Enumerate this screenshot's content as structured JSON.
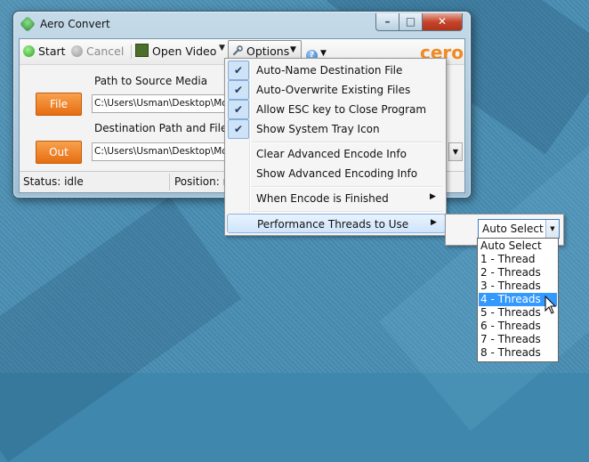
{
  "window": {
    "title": "Aero Convert",
    "controls": {
      "minimize": "–",
      "maximize": "□",
      "close": "✕"
    }
  },
  "toolbar": {
    "start": "Start",
    "cancel": "Cancel",
    "open_video": "Open Video",
    "options": "Options",
    "logo": "cero"
  },
  "source": {
    "label": "Path to Source Media",
    "button": "File",
    "path": "C:\\Users\\Usman\\Desktop\\Movies"
  },
  "destination": {
    "label": "Destination Path and Filename",
    "button": "Out",
    "path": "C:\\Users\\Usman\\Desktop\\Movies"
  },
  "status": {
    "status_text": "Status: idle",
    "position_text": "Position: n/a"
  },
  "options_menu": {
    "items": [
      {
        "label": "Auto-Name Destination File",
        "checked": true
      },
      {
        "label": "Auto-Overwrite Existing Files",
        "checked": true
      },
      {
        "label": "Allow ESC key to Close Program",
        "checked": true
      },
      {
        "label": "Show System Tray Icon",
        "checked": true
      },
      {
        "label": "Clear Advanced Encode Info"
      },
      {
        "label": "Show Advanced Encoding Info"
      },
      {
        "label": "When Encode is Finished",
        "submenu": true
      },
      {
        "label": "Performance Threads to Use",
        "submenu": true,
        "highlighted": true
      }
    ]
  },
  "threads": {
    "selected": "Auto Select",
    "options": [
      "Auto Select",
      "1 - Thread",
      "2 - Threads",
      "3 - Threads",
      "4 - Threads",
      "5 - Threads",
      "6 - Threads",
      "7 - Threads",
      "8 - Threads"
    ],
    "hovered_index": 4
  },
  "colors": {
    "accent_orange": "#e66d12",
    "selection_blue": "#3399ff",
    "desktop": "#4a8fb4"
  }
}
